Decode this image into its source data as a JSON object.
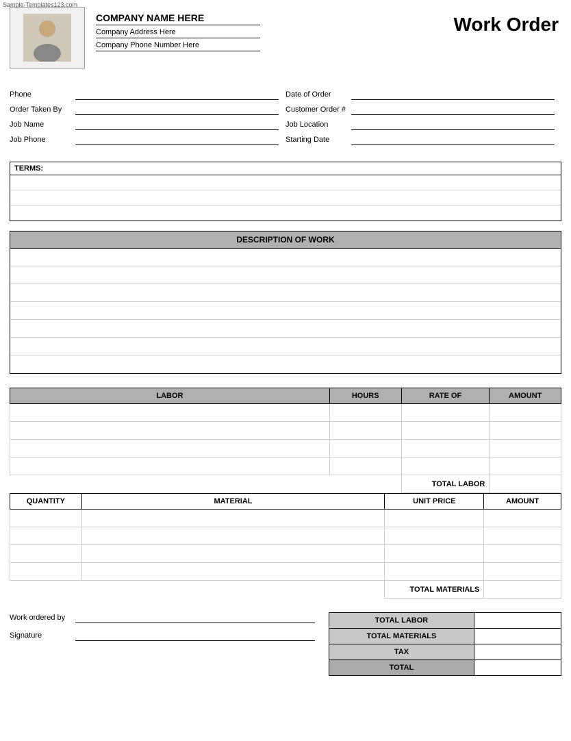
{
  "watermark": "Sample-Templates123.com",
  "header": {
    "company_name": "COMPANY NAME HERE",
    "company_address": "Company Address Here",
    "company_phone": "Company Phone Number Here",
    "title": "Work Order"
  },
  "form": {
    "left": [
      {
        "label": "Phone",
        "value": ""
      },
      {
        "label": "Order Taken By",
        "value": ""
      },
      {
        "label": "Job Name",
        "value": ""
      },
      {
        "label": "Job Phone",
        "value": ""
      }
    ],
    "right": [
      {
        "label": "Date of Order",
        "value": ""
      },
      {
        "label": "Customer Order #",
        "value": ""
      },
      {
        "label": "Job Location",
        "value": ""
      },
      {
        "label": "Starting Date",
        "value": ""
      }
    ]
  },
  "terms": {
    "label": "TERMS:",
    "rows": 3
  },
  "description": {
    "header": "DESCRIPTION OF WORK",
    "rows": 7
  },
  "labor": {
    "columns": [
      "LABOR",
      "HOURS",
      "RATE OF",
      "AMOUNT"
    ],
    "rows": 4,
    "total_label": "TOTAL LABOR"
  },
  "materials": {
    "columns": [
      "QUANTITY",
      "MATERIAL",
      "UNIT PRICE",
      "AMOUNT"
    ],
    "rows": 4,
    "total_label": "TOTAL MATERIALS"
  },
  "summary": {
    "work_ordered_label": "Work ordered by",
    "signature_label": "Signature",
    "totals": [
      {
        "label": "TOTAL LABOR",
        "value": ""
      },
      {
        "label": "TOTAL MATERIALS",
        "value": ""
      },
      {
        "label": "TAX",
        "value": ""
      },
      {
        "label": "TOTAL",
        "value": ""
      }
    ]
  }
}
